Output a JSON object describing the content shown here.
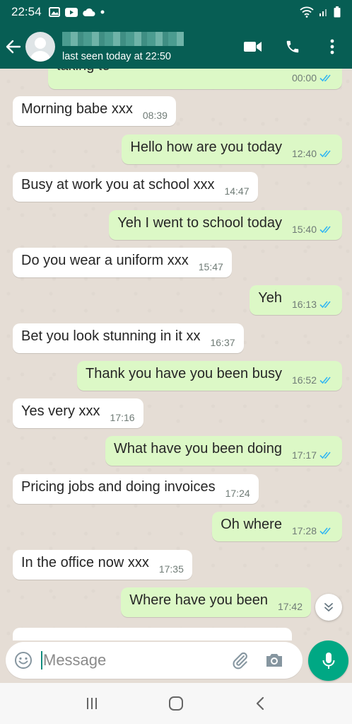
{
  "status_bar": {
    "time": "22:54"
  },
  "header": {
    "last_seen": "last seen today at 22:50"
  },
  "messages": [
    {
      "text": "taking to",
      "time": "00:00",
      "dir": "out",
      "read": true
    },
    {
      "text": "Morning babe xxx",
      "time": "08:39",
      "dir": "in"
    },
    {
      "text": "Hello how are you today",
      "time": "12:40",
      "dir": "out",
      "read": true
    },
    {
      "text": "Busy at work you at school xxx",
      "time": "14:47",
      "dir": "in"
    },
    {
      "text": "Yeh I went to school today",
      "time": "15:40",
      "dir": "out",
      "read": true
    },
    {
      "text": "Do you wear a uniform xxx",
      "time": "15:47",
      "dir": "in"
    },
    {
      "text": "Yeh",
      "time": "16:13",
      "dir": "out",
      "read": true
    },
    {
      "text": "Bet you look stunning in it xx",
      "time": "16:37",
      "dir": "in"
    },
    {
      "text": "Thank you have you been busy",
      "time": "16:52",
      "dir": "out",
      "read": true
    },
    {
      "text": "Yes very xxx",
      "time": "17:16",
      "dir": "in"
    },
    {
      "text": "What have you been doing",
      "time": "17:17",
      "dir": "out",
      "read": true
    },
    {
      "text": "Pricing jobs and doing invoices",
      "time": "17:24",
      "dir": "in"
    },
    {
      "text": "Oh where",
      "time": "17:28",
      "dir": "out",
      "read": true
    },
    {
      "text": "In the office now xxx",
      "time": "17:35",
      "dir": "in"
    },
    {
      "text": "Where have you been",
      "time": "17:42",
      "dir": "out",
      "read": true
    }
  ],
  "composer": {
    "placeholder": "Message"
  },
  "colors": {
    "header": "#075e54",
    "outgoing_bubble": "#dcf8c6",
    "incoming_bubble": "#ffffff",
    "chat_background": "#e5ddd5",
    "read_tick": "#34b7f1",
    "mic_button": "#00a884"
  },
  "icons": {
    "back": "arrow-left-icon",
    "video": "video-camera-icon",
    "call": "phone-icon",
    "menu": "more-vertical-icon",
    "emoji": "emoji-icon",
    "attach": "paperclip-icon",
    "camera": "camera-icon",
    "mic": "microphone-icon",
    "scroll_down": "double-chevron-down-icon"
  }
}
